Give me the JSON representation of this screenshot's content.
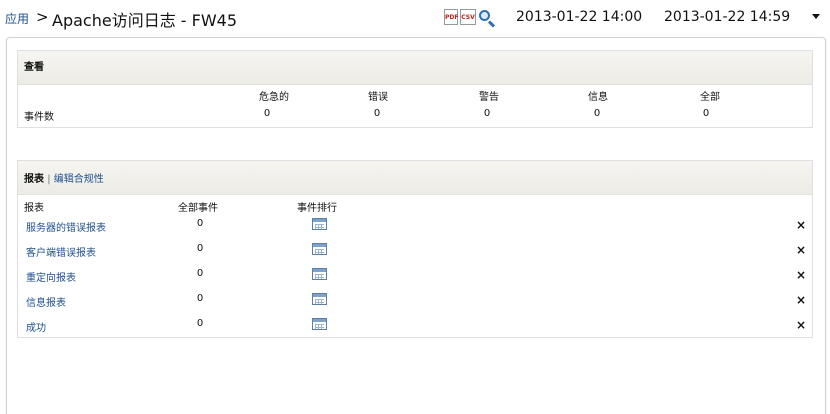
{
  "header": {
    "breadcrumb": "应用",
    "separator": ">",
    "title": "Apache访问日志 - FW45",
    "pdf_icon_text": "PDF",
    "csv_icon_text": "CSV",
    "start_time": "2013-01-22 14:00",
    "end_time": "2013-01-22 14:59"
  },
  "view_panel": {
    "title": "查看",
    "columns": [
      "危急的",
      "错误",
      "警告",
      "信息",
      "全部"
    ],
    "row_label": "事件数",
    "values": [
      "0",
      "0",
      "0",
      "0",
      "0"
    ]
  },
  "report_panel": {
    "title": "报表",
    "divider": "|",
    "edit_link": "编辑合规性",
    "col_report": "报表",
    "col_total": "全部事件",
    "col_rank": "事件排行",
    "rows": [
      {
        "name": "服务器的错误报表",
        "total": "0"
      },
      {
        "name": "客户端错误报表",
        "total": "0"
      },
      {
        "name": "重定向报表",
        "total": "0"
      },
      {
        "name": "信息报表",
        "total": "0"
      },
      {
        "name": "成功",
        "total": "0"
      }
    ],
    "remove_glyph": "×"
  }
}
